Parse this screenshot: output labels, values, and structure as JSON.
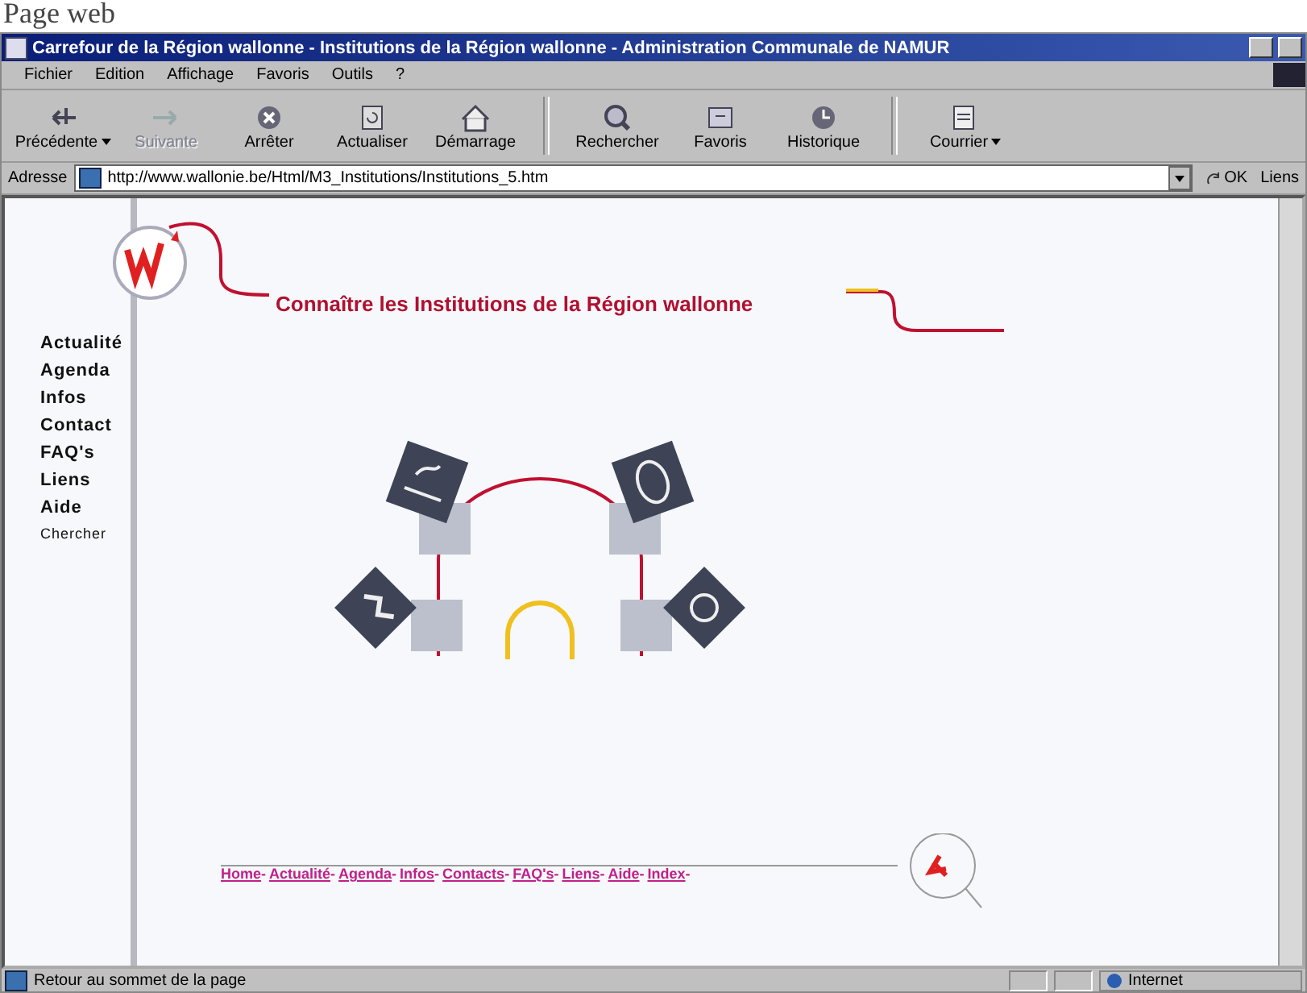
{
  "caption": "Page web",
  "window": {
    "title": "Carrefour de la Région wallonne - Institutions de la Région wallonne - Administration Communale de NAMUR"
  },
  "menu": [
    "Fichier",
    "Edition",
    "Affichage",
    "Favoris",
    "Outils",
    "?"
  ],
  "toolbar": [
    [
      {
        "label": "Précédente",
        "kind": "back",
        "disabled": false,
        "dropdown": true
      },
      {
        "label": "Suivante",
        "kind": "forward",
        "disabled": true,
        "dropdown": false
      },
      {
        "label": "Arrêter",
        "kind": "stop",
        "disabled": false,
        "dropdown": false
      },
      {
        "label": "Actualiser",
        "kind": "refresh",
        "disabled": false,
        "dropdown": false
      },
      {
        "label": "Démarrage",
        "kind": "home",
        "disabled": false,
        "dropdown": false
      }
    ],
    [
      {
        "label": "Rechercher",
        "kind": "search",
        "disabled": false,
        "dropdown": false
      },
      {
        "label": "Favoris",
        "kind": "favorites",
        "disabled": false,
        "dropdown": false
      },
      {
        "label": "Historique",
        "kind": "history",
        "disabled": false,
        "dropdown": false
      }
    ],
    [
      {
        "label": "Courrier",
        "kind": "mail",
        "disabled": false,
        "dropdown": true
      }
    ]
  ],
  "address": {
    "label": "Adresse",
    "value": "http://www.wallonie.be/Html/M3_Institutions/Institutions_5.htm",
    "go": "OK",
    "links": "Liens"
  },
  "page": {
    "heading": "Connaître les Institutions de la Région wallonne",
    "sidebar": [
      {
        "label": "Actualité",
        "kind": "main"
      },
      {
        "label": "Agenda",
        "kind": "main"
      },
      {
        "label": "Infos",
        "kind": "main"
      },
      {
        "label": "Contact",
        "kind": "main"
      },
      {
        "label": "FAQ's",
        "kind": "main"
      },
      {
        "label": "Liens",
        "kind": "main"
      },
      {
        "label": "Aide",
        "kind": "main"
      },
      {
        "label": "Chercher",
        "kind": "small"
      }
    ],
    "footer_links": [
      "Home",
      "Actualité",
      "Agenda",
      "Infos",
      "Contacts",
      "FAQ's",
      "Liens",
      "Aide",
      "Index"
    ],
    "footer_separator": "-"
  },
  "status_bar": {
    "message": "Retour au sommet de la page",
    "zone": "Internet"
  }
}
